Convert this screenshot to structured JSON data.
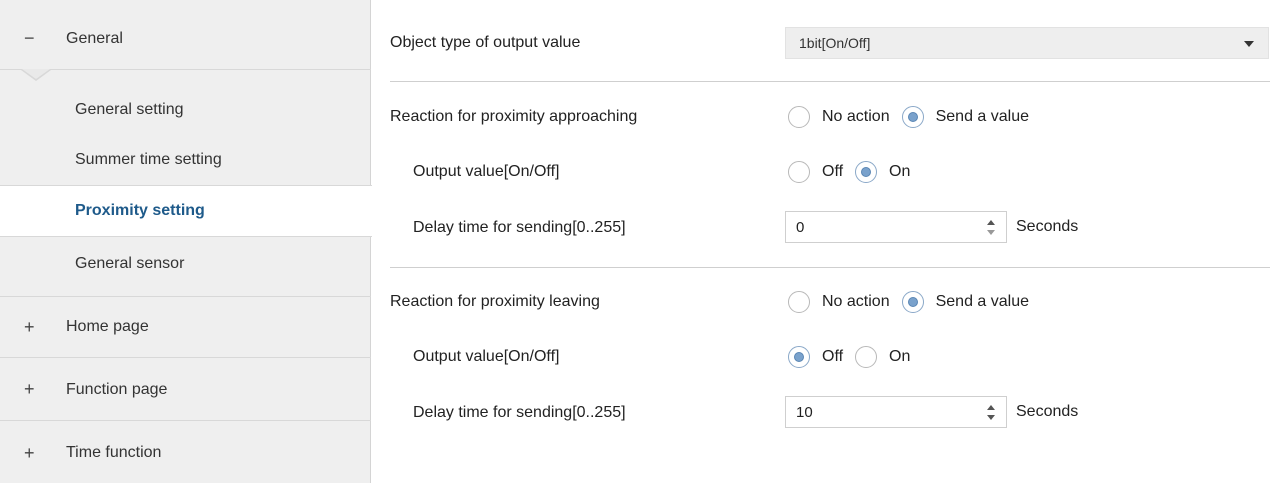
{
  "sidebar": {
    "general": {
      "sign": "−",
      "label": "General"
    },
    "sub_items": [
      "General setting",
      "Summer time setting",
      "Proximity setting",
      "General sensor"
    ],
    "groups": [
      {
        "sign": "+",
        "label": "Home page"
      },
      {
        "sign": "+",
        "label": "Function page"
      },
      {
        "sign": "+",
        "label": "Time function"
      }
    ]
  },
  "main": {
    "object_type": {
      "label": "Object type of output value",
      "value": "1bit[On/Off]"
    },
    "approaching": {
      "label": "Reaction for proximity approaching",
      "options": [
        "No action",
        "Send a value"
      ],
      "selected": "Send a value",
      "output": {
        "label": "Output value[On/Off]",
        "options": [
          "Off",
          "On"
        ],
        "selected": "On"
      },
      "delay": {
        "label": "Delay time for sending[0..255]",
        "value": "0",
        "unit": "Seconds"
      }
    },
    "leaving": {
      "label": "Reaction for proximity leaving",
      "options": [
        "No action",
        "Send a value"
      ],
      "selected": "Send a value",
      "output": {
        "label": "Output value[On/Off]",
        "options": [
          "Off",
          "On"
        ],
        "selected": "Off"
      },
      "delay": {
        "label": "Delay time for sending[0..255]",
        "value": "10",
        "unit": "Seconds"
      }
    }
  },
  "colors": {
    "active_item": "#1e5a8a",
    "radio_selected": "#7aa2cc",
    "sidebar_bg": "#efefef"
  }
}
